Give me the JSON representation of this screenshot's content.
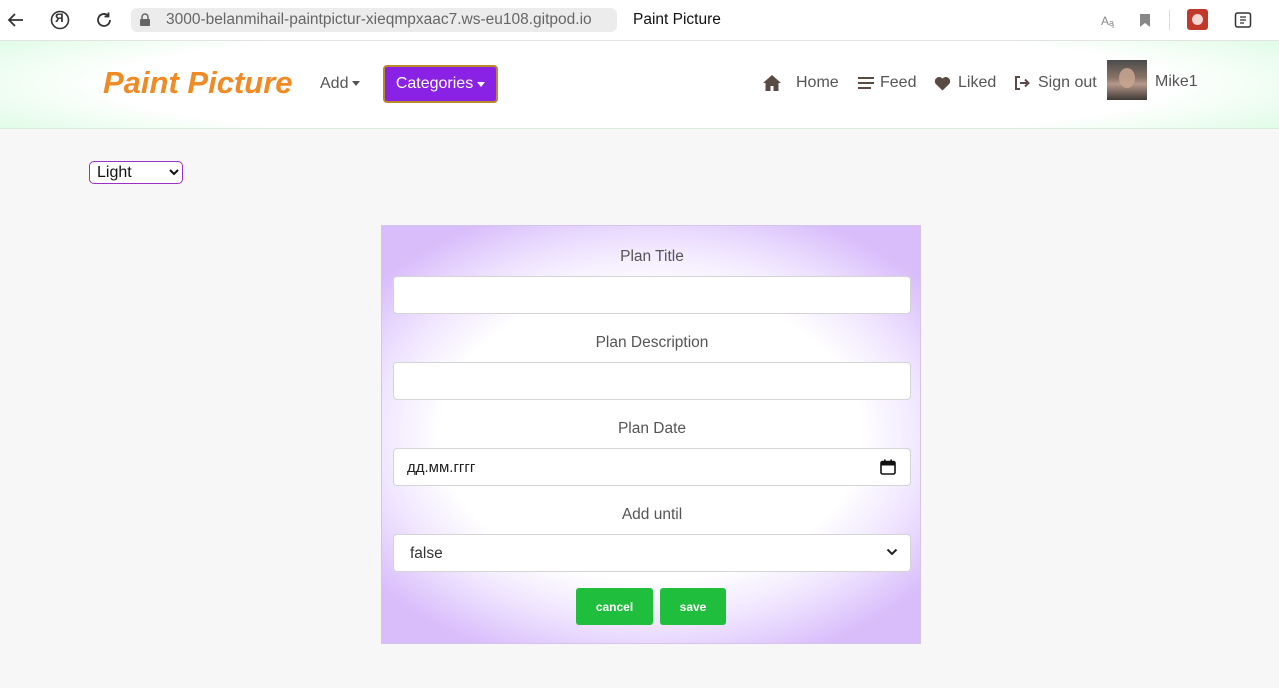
{
  "browser": {
    "url": "3000-belanmihail-paintpictur-xieqmpxaac7.ws-eu108.gitpod.io",
    "tab_title": "Paint Picture",
    "ya_glyph": "Я"
  },
  "navbar": {
    "brand": "Paint Picture",
    "add_label": "Add",
    "categories_label": "Categories",
    "links": {
      "home": "Home",
      "feed": "Feed",
      "liked": "Liked",
      "signout": "Sign out"
    },
    "username": "Mike1"
  },
  "theme_select": {
    "value": "Light"
  },
  "form": {
    "title_label": "Plan Title",
    "title_value": "",
    "description_label": "Plan Description",
    "description_value": "",
    "date_label": "Plan Date",
    "date_value": "дд.мм.гггг",
    "until_label": "Add until",
    "until_value": "false",
    "cancel_label": "cancel",
    "save_label": "save"
  },
  "colors": {
    "brand": "#f08a24",
    "categories_bg": "#8a22e6",
    "button_green": "#1fbe3c"
  }
}
